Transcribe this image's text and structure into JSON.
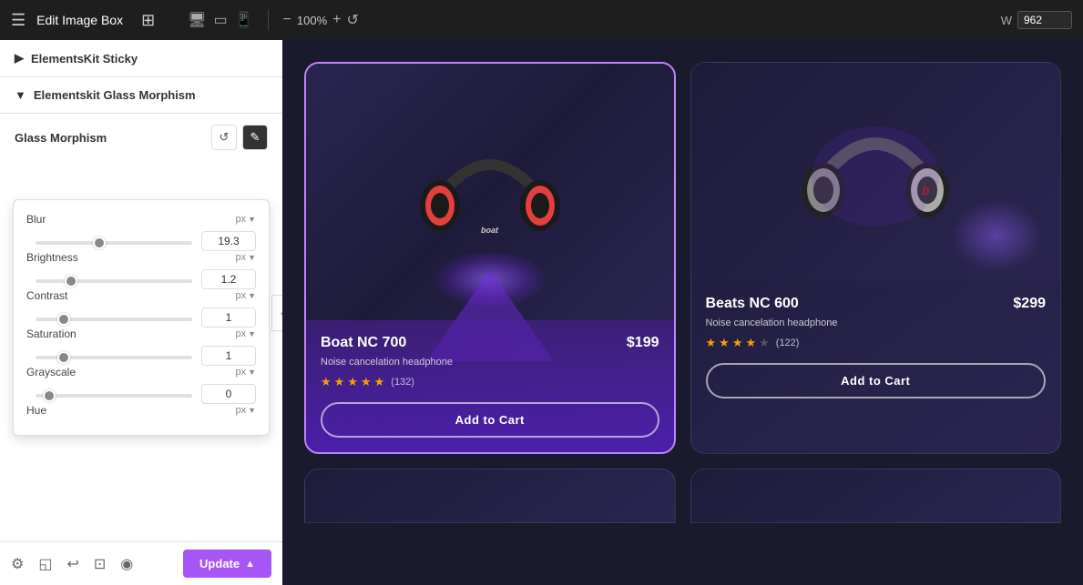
{
  "topbar": {
    "title": "Edit Image Box",
    "zoom": "100%",
    "width_label": "W",
    "width_value": "962"
  },
  "panel": {
    "sticky_section": "ElementsKit Sticky",
    "glass_section": "Elementskit Glass Morphism",
    "glass_morphism_label": "Glass Morphism",
    "reset_icon": "↺",
    "edit_icon": "✎"
  },
  "filters": {
    "blur": {
      "label": "Blur",
      "unit": "px",
      "value": "19.3",
      "slider_value": 40
    },
    "brightness": {
      "label": "Brightness",
      "unit": "px",
      "value": "1.2",
      "slider_value": 20
    },
    "contrast": {
      "label": "Contrast",
      "unit": "px",
      "value": "1",
      "slider_value": 15
    },
    "saturation": {
      "label": "Saturation",
      "unit": "px",
      "value": "1",
      "slider_value": 15
    },
    "grayscale": {
      "label": "Grayscale",
      "unit": "px",
      "value": "0",
      "slider_value": 5
    },
    "hue": {
      "label": "Hue",
      "unit": "px",
      "value": ""
    }
  },
  "products": [
    {
      "id": "boat",
      "name": "Boat NC 700",
      "price": "$199",
      "description": "Noise cancelation headphone",
      "stars": 5,
      "reviews": "(132)",
      "add_to_cart": "Add to Cart",
      "selected": true
    },
    {
      "id": "beats",
      "name": "Beats NC 600",
      "price": "$299",
      "description": "Noise cancelation headphone",
      "stars": 4,
      "reviews": "(122)",
      "add_to_cart": "Add to Cart",
      "selected": false
    }
  ],
  "toolbar": {
    "update_label": "Update",
    "icons": [
      "⚙",
      "◱",
      "↩",
      "⊡",
      "◉"
    ]
  }
}
